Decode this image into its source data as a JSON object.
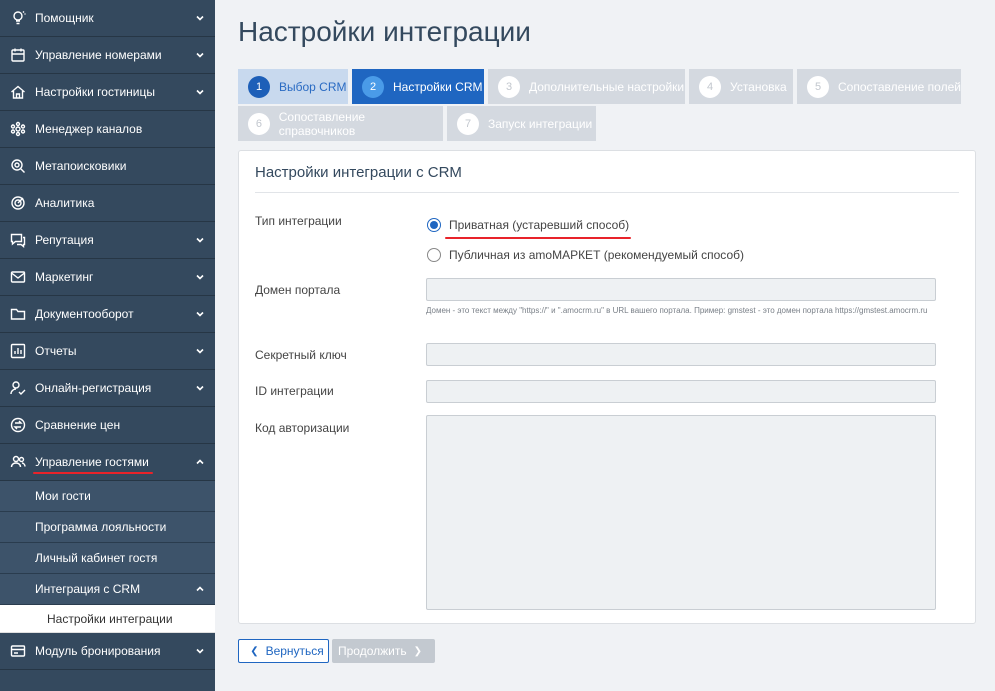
{
  "sidebar": {
    "items": [
      {
        "label": "Помощник",
        "icon": "lightbulb-icon",
        "chevron": "down"
      },
      {
        "label": "Управление номерами",
        "icon": "calendar-icon",
        "chevron": "down"
      },
      {
        "label": "Настройки гостиницы",
        "icon": "hotel-icon",
        "chevron": "down"
      },
      {
        "label": "Менеджер каналов",
        "icon": "channels-icon",
        "chevron": ""
      },
      {
        "label": "Метапоисковики",
        "icon": "search-icon",
        "chevron": ""
      },
      {
        "label": "Аналитика",
        "icon": "target-icon",
        "chevron": ""
      },
      {
        "label": "Репутация",
        "icon": "chat-icon",
        "chevron": "down"
      },
      {
        "label": "Маркетинг",
        "icon": "mail-icon",
        "chevron": "down"
      },
      {
        "label": "Документооборот",
        "icon": "folder-icon",
        "chevron": "down"
      },
      {
        "label": "Отчеты",
        "icon": "bar-chart-icon",
        "chevron": "down"
      },
      {
        "label": "Онлайн-регистрация",
        "icon": "user-check-icon",
        "chevron": "down"
      },
      {
        "label": "Сравнение цен",
        "icon": "price-compare-icon",
        "chevron": ""
      },
      {
        "label": "Управление гостями",
        "icon": "users-icon",
        "chevron": "up"
      }
    ],
    "sub_items": [
      {
        "label": "Мои гости"
      },
      {
        "label": "Программа лояльности"
      },
      {
        "label": "Личный кабинет гостя"
      },
      {
        "label": "Интеграция с CRM"
      }
    ],
    "sub_sub_items": [
      {
        "label": "Настройки интеграции"
      }
    ],
    "bottom_item": {
      "label": "Модуль бронирования",
      "icon": "booking-icon"
    }
  },
  "main": {
    "title": "Настройки интеграции",
    "steps": [
      {
        "num": "1",
        "label": "Выбор CRM",
        "state": "done"
      },
      {
        "num": "2",
        "label": "Настройки CRM",
        "state": "active"
      },
      {
        "num": "3",
        "label": "Дополнительные настройки",
        "state": "todo"
      },
      {
        "num": "4",
        "label": "Установка",
        "state": "todo"
      },
      {
        "num": "5",
        "label": "Сопоставление полей",
        "state": "todo"
      },
      {
        "num": "6",
        "label": "Сопоставление справочников",
        "state": "todo"
      },
      {
        "num": "7",
        "label": "Запуск интеграции",
        "state": "todo"
      }
    ],
    "card": {
      "title": "Настройки интеграции с CRM",
      "integration_type_label": "Тип интеграции",
      "radio_private": "Приватная (устаревший способ)",
      "radio_public": "Публичная из amoМАРКЕТ (рекомендуемый способ)",
      "domain_label": "Домен портала",
      "domain_value": "",
      "domain_hint": "Домен - это текст между \"https://\" и \".amocrm.ru\" в URL вашего портала. Пример: gmstest - это домен портала https://gmstest.amocrm.ru",
      "secret_label": "Секретный ключ",
      "secret_value": "",
      "id_label": "ID интеграции",
      "id_value": "",
      "code_label": "Код авторизации",
      "code_value": ""
    },
    "buttons": {
      "back": "Вернуться",
      "next": "Продолжить"
    }
  },
  "colors": {
    "sidebar_bg": "#34495e",
    "accent": "#1f66c1",
    "underline_red": "#e8232a"
  }
}
